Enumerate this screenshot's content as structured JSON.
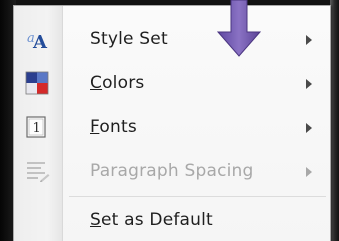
{
  "menu": {
    "items": [
      {
        "label": "Style Set",
        "underline": "",
        "rest": "Style Set",
        "icon": "style-set-icon",
        "has_submenu": true,
        "enabled": true
      },
      {
        "label": "Colors",
        "underline": "C",
        "rest": "olors",
        "icon": "colors-icon",
        "has_submenu": true,
        "enabled": true
      },
      {
        "label": "Fonts",
        "underline": "F",
        "rest": "onts",
        "icon": "fonts-icon",
        "has_submenu": true,
        "enabled": true
      },
      {
        "label": "Paragraph Spacing",
        "underline": "",
        "rest": "Paragraph Spacing",
        "icon": "paragraph-spacing-icon",
        "has_submenu": true,
        "enabled": false
      },
      {
        "label": "Set as Default",
        "underline": "S",
        "rest": "et as Default",
        "icon": "",
        "has_submenu": false,
        "enabled": true
      }
    ]
  },
  "colors": {
    "menu_bg": "#f7f7f7",
    "text": "#1f1f1f",
    "disabled_text": "#a8a8a8",
    "annotation_arrow": "#7b5fb3"
  },
  "annotation": {
    "icon": "purple-down-arrow-icon"
  }
}
